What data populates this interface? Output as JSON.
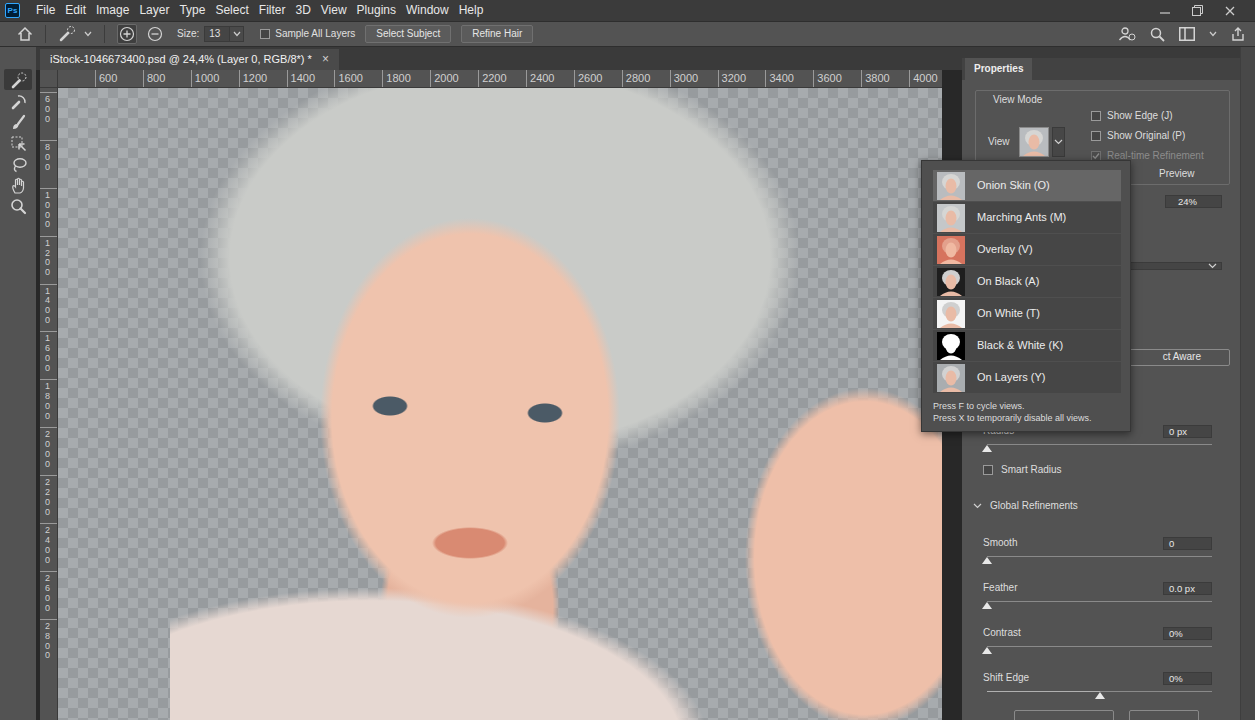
{
  "app": {
    "logo": "Ps"
  },
  "menu": [
    "File",
    "Edit",
    "Image",
    "Layer",
    "Type",
    "Select",
    "Filter",
    "3D",
    "View",
    "Plugins",
    "Window",
    "Help"
  ],
  "options_bar": {
    "modes": [
      {
        "kind": "add",
        "selected": true
      },
      {
        "kind": "subtract",
        "selected": false
      }
    ],
    "size_label": "Size:",
    "size_value": "13",
    "sample_all_layers": {
      "label": "Sample All Layers",
      "checked": false
    },
    "buttons": [
      "Select Subject",
      "Refine Hair"
    ]
  },
  "document_tab": {
    "title": "iStock-1046673400.psd @ 24,4% (Layer 0, RGB/8*) *",
    "close": "×",
    "selected": true
  },
  "rulers": {
    "top": [
      "600",
      "800",
      "1000",
      "1200",
      "1400",
      "1600",
      "1800",
      "2000",
      "2200",
      "2400",
      "2600",
      "2800",
      "3000",
      "3200",
      "3400",
      "3600",
      "3800",
      "4000"
    ],
    "left": [
      "600",
      "800",
      "1000",
      "1200",
      "1400",
      "1600",
      "1800",
      "2000",
      "2200",
      "2400",
      "2600",
      "2800"
    ]
  },
  "tools": [
    {
      "kind": "quickselect",
      "selected": true
    },
    {
      "kind": "refineedge",
      "selected": false
    },
    {
      "kind": "brush",
      "selected": false
    },
    {
      "kind": "objectselect",
      "selected": false
    },
    {
      "kind": "lasso",
      "selected": false
    },
    {
      "kind": "hand",
      "selected": false
    },
    {
      "kind": "zoom",
      "selected": false
    }
  ],
  "properties": {
    "tab": {
      "label": "Properties",
      "selected": true
    },
    "view_mode": {
      "title": "View Mode",
      "view_label": "View",
      "options": [
        {
          "label": "Show Edge (J)",
          "checked": false,
          "disabled": false
        },
        {
          "label": "Show Original (P)",
          "checked": false,
          "disabled": false
        },
        {
          "label": "Real-time Refinement",
          "checked": true,
          "disabled": true
        }
      ],
      "preview_label": "Preview"
    },
    "percent_value": "24%",
    "aware_button": "ct Aware",
    "radius": {
      "label": "Radius",
      "value": "0 px",
      "level": 0
    },
    "smart_radius": {
      "label": "Smart Radius",
      "checked": false
    },
    "global_refinements": {
      "title": "Global Refinements",
      "expanded": true,
      "sliders": [
        {
          "label": "Smooth",
          "value": "0",
          "level": 0
        },
        {
          "label": "Feather",
          "value": "0.0 px",
          "level": 0
        },
        {
          "label": "Contrast",
          "value": "0%",
          "level": 0
        },
        {
          "label": "Shift Edge",
          "value": "0%",
          "level": 0.5
        }
      ]
    }
  },
  "view_menu": {
    "items": [
      {
        "label": "Onion Skin (O)",
        "kind": "onion",
        "selected": true
      },
      {
        "label": "Marching Ants (M)",
        "kind": "ants",
        "selected": false
      },
      {
        "label": "Overlay (V)",
        "kind": "overlay",
        "selected": false
      },
      {
        "label": "On Black (A)",
        "kind": "black",
        "selected": false
      },
      {
        "label": "On White (T)",
        "kind": "white",
        "selected": false
      },
      {
        "label": "Black & White (K)",
        "kind": "bw",
        "selected": false
      },
      {
        "label": "On Layers (Y)",
        "kind": "layers",
        "selected": false
      }
    ],
    "hints": [
      "Press F to cycle views.",
      "Press X to temporarily disable all views."
    ]
  }
}
